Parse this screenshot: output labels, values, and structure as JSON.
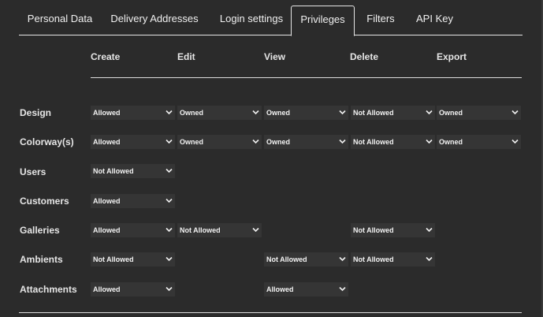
{
  "tabs": [
    {
      "label": "Personal Data"
    },
    {
      "label": "Delivery Addresses"
    },
    {
      "label": "Login settings"
    },
    {
      "label": "Privileges"
    },
    {
      "label": "Filters"
    },
    {
      "label": "API Key"
    }
  ],
  "active_tab": "Privileges",
  "columns": [
    "Create",
    "Edit",
    "View",
    "Delete",
    "Export"
  ],
  "rows": [
    {
      "label": "Design",
      "cells": [
        "Allowed",
        "Owned",
        "Owned",
        "Not Allowed",
        "Owned"
      ]
    },
    {
      "label": "Colorway(s)",
      "cells": [
        "Allowed",
        "Owned",
        "Owned",
        "Not Allowed",
        "Owned"
      ]
    },
    {
      "label": "Users",
      "cells": [
        "Not Allowed",
        null,
        null,
        null,
        null
      ]
    },
    {
      "label": "Customers",
      "cells": [
        "Allowed",
        null,
        null,
        null,
        null
      ]
    },
    {
      "label": "Galleries",
      "cells": [
        "Allowed",
        "Not Allowed",
        null,
        "Not Allowed",
        null
      ]
    },
    {
      "label": "Ambients",
      "cells": [
        "Not Allowed",
        null,
        "Not Allowed",
        "Not Allowed",
        null
      ]
    },
    {
      "label": "Attachments",
      "cells": [
        "Allowed",
        null,
        "Allowed",
        null,
        null
      ]
    }
  ],
  "icons": {
    "dropdown": "chevron-down-icon"
  },
  "colors": {
    "background": "#2b2b2b",
    "select_bg": "#353535",
    "text": "#e6e6e6"
  }
}
